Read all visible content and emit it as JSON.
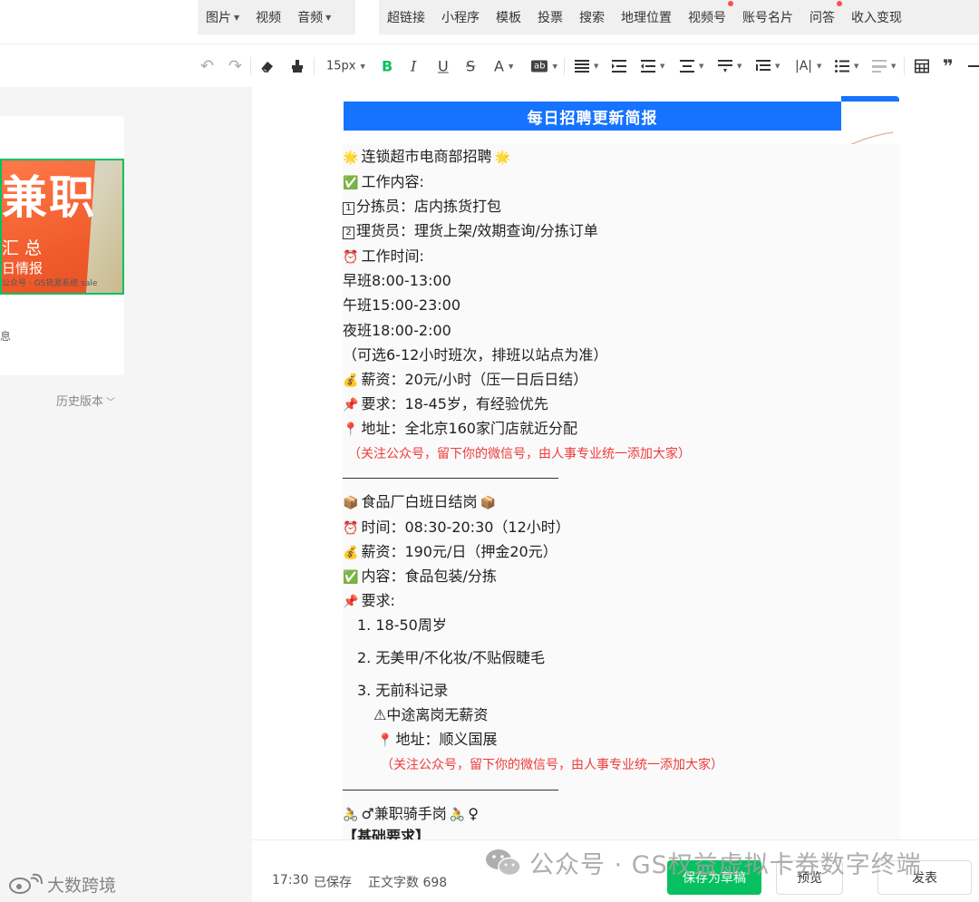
{
  "insert_menu": {
    "media": [
      {
        "label": "图片",
        "has_caret": true
      },
      {
        "label": "视频",
        "has_caret": false
      },
      {
        "label": "音频",
        "has_caret": true
      }
    ],
    "more": [
      {
        "label": "超链接",
        "dot": false
      },
      {
        "label": "小程序",
        "dot": false
      },
      {
        "label": "模板",
        "dot": false
      },
      {
        "label": "投票",
        "dot": false
      },
      {
        "label": "搜索",
        "dot": false
      },
      {
        "label": "地理位置",
        "dot": false
      },
      {
        "label": "视频号",
        "dot": true
      },
      {
        "label": "账号名片",
        "dot": false
      },
      {
        "label": "问答",
        "dot": true
      },
      {
        "label": "收入变现",
        "dot": false
      }
    ]
  },
  "toolbar": {
    "font_size": "15px",
    "bold": "B",
    "italic": "I",
    "underline": "U",
    "strike": "S",
    "font_color": "A",
    "bg_color": "ab",
    "letter_spacing": "|A|",
    "accent": "#07c160"
  },
  "sidebar": {
    "cover": {
      "big_text": "兼职",
      "sub_text": "汇总",
      "info_text": "日情报",
      "source_text": "公众号 · GS货源系统 sale",
      "caption": "息"
    },
    "history_label": "历史版本"
  },
  "article": {
    "banner_title": "每日招聘更新简报",
    "banner_color": "#1673ff",
    "note_color": "#ef3b3b",
    "section1": {
      "title": "连锁超市电商部招聘",
      "content_label": "工作内容:",
      "item1": "分拣员：店内拣货打包",
      "item2": "理货员：理货上架/效期查询/分拣订单",
      "time_label": "工作时间:",
      "shift_morning": "早班8:00-13:00",
      "shift_afternoon": "午班15:00-23:00",
      "shift_night": "夜班18:00-2:00",
      "shift_note": "（可选6-12小时班次，排班以站点为准）",
      "salary": "薪资：20元/小时（压一日后日结）",
      "requirement": "要求：18-45岁，有经验优先",
      "address": "地址：全北京160家门店就近分配",
      "follow_note": "（关注公众号，留下你的微信号，由人事专业统一添加大家）"
    },
    "section2": {
      "title": "食品厂白班日结岗",
      "time": "时间：08:30-20:30（12小时）",
      "salary": "薪资：190元/日（押金20元）",
      "content": "内容：食品包装/分拣",
      "req_label": "要求:",
      "req1": "1. 18-50周岁",
      "req2": "2. 无美甲/不化妆/不贴假睫毛",
      "req3": "3. 无前科记录",
      "warning": "中途离岗无薪资",
      "address": "地址：顺义国展",
      "follow_note": "（关注公众号，留下你的微信号，由人事专业统一添加大家）"
    },
    "section3": {
      "title": "♂兼职骑手岗",
      "title_suffix": "♀",
      "basic_req": "【基础要求】"
    }
  },
  "status": {
    "time": "17:30",
    "saved": "已保存",
    "word_count": "正文字数  698"
  },
  "actions": {
    "draft": "保存为草稿",
    "preview": "预览",
    "publish": "发表"
  },
  "watermarks": {
    "right": "公众号 · GS权益虚拟卡券数字终端",
    "left": "大数跨境"
  }
}
